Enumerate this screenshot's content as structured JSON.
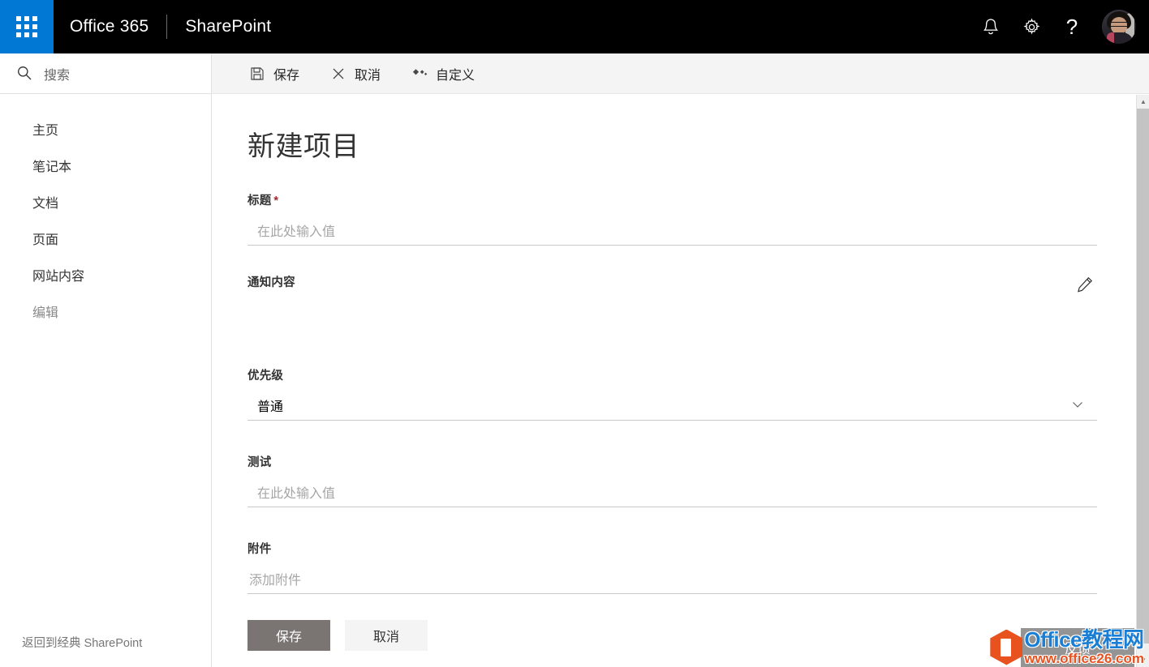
{
  "suite": {
    "waffle_icon": "waffle-grid-icon",
    "brand": "Office 365",
    "app_name": "SharePoint",
    "notifications_icon": "bell-icon",
    "settings_icon": "gear-icon",
    "help_icon": "question-mark-icon",
    "avatar_alt": "user-avatar"
  },
  "sidebar": {
    "search": {
      "icon": "search-icon",
      "label": "搜索",
      "placeholder": "搜索"
    },
    "items": [
      {
        "label": "主页",
        "muted": false
      },
      {
        "label": "笔记本",
        "muted": false
      },
      {
        "label": "文档",
        "muted": false
      },
      {
        "label": "页面",
        "muted": false
      },
      {
        "label": "网站内容",
        "muted": false
      },
      {
        "label": "编辑",
        "muted": true
      }
    ],
    "classic_link": "返回到经典 SharePoint"
  },
  "commandbar": {
    "save": {
      "icon": "save-floppy-icon",
      "label": "保存"
    },
    "cancel": {
      "icon": "close-x-icon",
      "label": "取消"
    },
    "customize": {
      "icon": "customize-diamonds-icon",
      "label": "自定义"
    }
  },
  "form": {
    "title": "新建项目",
    "fields": {
      "title": {
        "label": "标题",
        "required_marker": "*",
        "placeholder": "在此处输入值",
        "value": ""
      },
      "notice": {
        "label": "通知内容",
        "edit_icon": "pencil-edit-icon",
        "value": ""
      },
      "priority": {
        "label": "优先级",
        "value": "普通",
        "chevron_icon": "chevron-down-icon"
      },
      "test": {
        "label": "测试",
        "placeholder": "在此处输入值",
        "value": ""
      },
      "attachments": {
        "label": "附件",
        "placeholder": "添加附件",
        "value": ""
      }
    },
    "buttons": {
      "save": "保存",
      "cancel": "取消"
    }
  },
  "feedback": {
    "label": "反馈"
  },
  "watermark": {
    "site_name": "Office教程网",
    "url": "www.office26.com"
  },
  "scrollbar": {
    "up_arrow": "scroll-up-arrow-icon",
    "down_arrow": "scroll-down-arrow-icon"
  },
  "colors": {
    "suite_bar": "#000000",
    "waffle_blue": "#0078d4",
    "command_bar": "#f4f4f4",
    "required_red": "#a4262c",
    "primary_button": "#7a7572",
    "feedback_gray": "#949494",
    "watermark_blue": "#1a7fd4",
    "watermark_orange": "#e8521f"
  }
}
